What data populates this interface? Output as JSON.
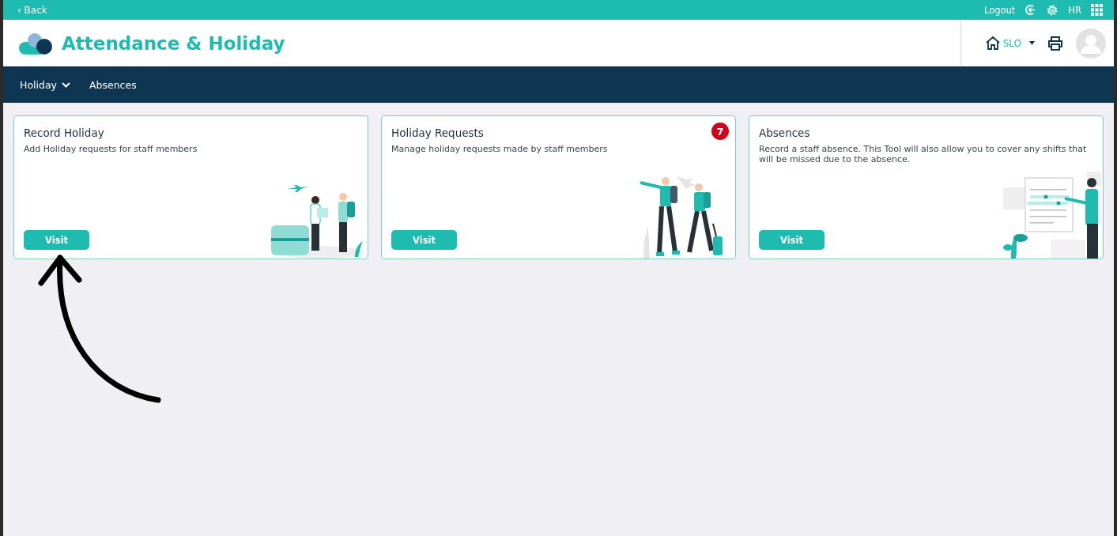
{
  "top_bar": {
    "back": "‹ Back",
    "logout": "Logout",
    "user_initials": "HR"
  },
  "header": {
    "title": "Attendance & Holiday",
    "site": "SLO"
  },
  "nav": [
    {
      "label": "Holiday",
      "dropdown": true
    },
    {
      "label": "Absences",
      "dropdown": false
    }
  ],
  "cards": [
    {
      "title": "Record Holiday",
      "description": "Add Holiday requests for staff members",
      "button": "Visit",
      "kind": "travellers"
    },
    {
      "title": "Holiday Requests",
      "description": "Manage holiday requests made by staff members",
      "button": "Visit",
      "badge": "7",
      "kind": "walkers"
    },
    {
      "title": "Absences",
      "description": "Record a staff absence. This Tool will also allow you to cover any shifts that will be missed due to the absence.",
      "button": "Visit",
      "kind": "calendar"
    }
  ]
}
